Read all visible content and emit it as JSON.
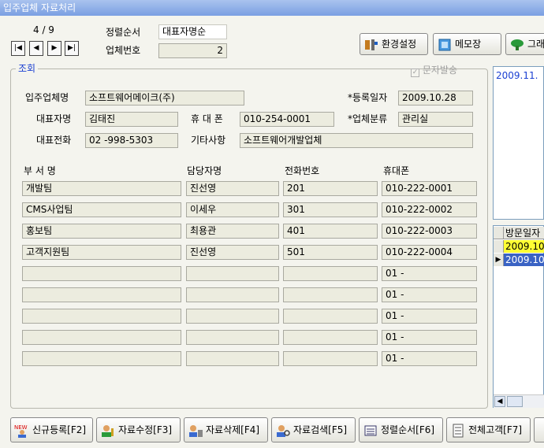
{
  "window": {
    "title": "입주업체 자료처리"
  },
  "nav": {
    "position": "4 / 9",
    "first": "|◀",
    "prev": "◀",
    "next": "▶",
    "last": "▶|"
  },
  "sort": {
    "label": "정렬순서",
    "value": "대표자명순",
    "company_no_label": "업체번호",
    "company_no": "2"
  },
  "toolbar": {
    "settings": "환경설정",
    "memo": "메모장",
    "graph": "그래"
  },
  "group": {
    "title": "조회",
    "sms_label": "문자발송"
  },
  "form": {
    "company_name_label": "입주업체명",
    "company_name": "소프트웨어메이크(주)",
    "reg_date_label": "*등록일자",
    "reg_date": "2009.10.28",
    "ceo_label": "대표자명",
    "ceo": "김태진",
    "mobile_label": "휴 대 폰",
    "mobile": "010-254-0001",
    "category_label": "*업체분류",
    "category": "관리실",
    "tel_label": "대표전화",
    "tel": "02   -998-5303",
    "misc_label": "기타사항",
    "misc": "소프트웨어개발업체"
  },
  "dept_table": {
    "headers": [
      "부 서 명",
      "담당자명",
      "전화번호",
      "휴대폰"
    ],
    "rows": [
      [
        "개발팀",
        "진선영",
        "201",
        "010-222-0001"
      ],
      [
        "CMS사업팀",
        "이세우",
        "301",
        "010-222-0002"
      ],
      [
        "홍보팀",
        "최용관",
        "401",
        "010-222-0003"
      ],
      [
        "고객지원팀",
        "진선영",
        "501",
        "010-222-0004"
      ],
      [
        "",
        "",
        "",
        "01  -"
      ],
      [
        "",
        "",
        "",
        "01  -"
      ],
      [
        "",
        "",
        "",
        "01  -"
      ],
      [
        "",
        "",
        "",
        "01  -"
      ],
      [
        "",
        "",
        "",
        "01  -"
      ]
    ]
  },
  "right_panel": {
    "memo_text": "2009.11.",
    "visit_header": "방문일자",
    "visits": [
      "2009.10.",
      "2009.10."
    ]
  },
  "bottom_buttons": [
    "신규등록[F2]",
    "자료수정[F3]",
    "자료삭제[F4]",
    "자료검색[F5]",
    "정렬순서[F6]",
    "전체고객[F7]"
  ]
}
